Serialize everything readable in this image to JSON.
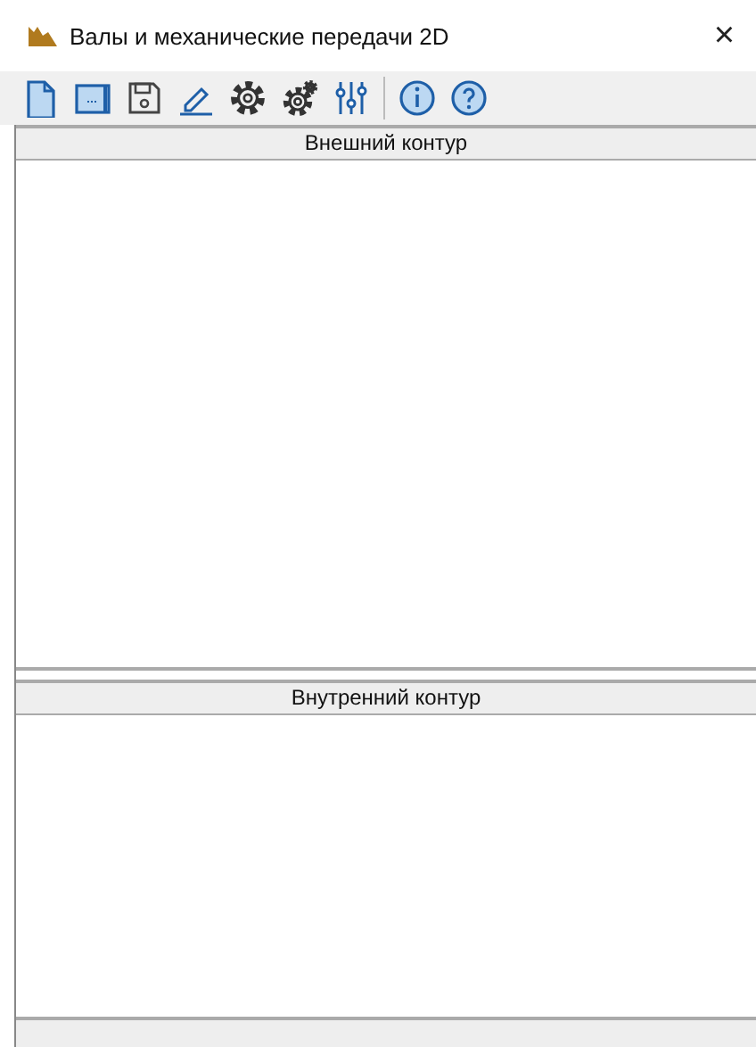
{
  "window": {
    "title": "Валы и механические передачи 2D",
    "close": "×"
  },
  "panes": [
    {
      "header": "Внешний контур"
    },
    {
      "header": "Внутренний контур"
    }
  ]
}
